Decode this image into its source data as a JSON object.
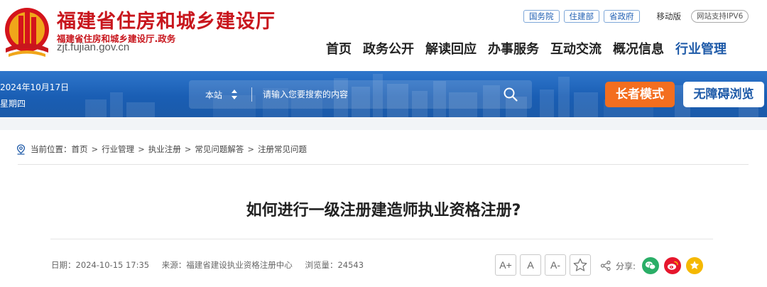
{
  "header": {
    "site_name": "福建省住房和城乡建设厅",
    "site_sub": "福建省住房和城乡建设厅.政务",
    "site_domain": "zjt.fujian.gov.cn",
    "top_links": [
      "国务院",
      "住建部",
      "省政府"
    ],
    "mobile_label": "移动版",
    "ipv6_label": "网站支持IPV6",
    "nav": [
      "首页",
      "政务公开",
      "解读回应",
      "办事服务",
      "互动交流",
      "概况信息",
      "行业管理"
    ],
    "active_nav": "行业管理"
  },
  "banner": {
    "date": "2024年10月17日",
    "weekday": "星期四",
    "search": {
      "scope": "本站",
      "placeholder": "请输入您要搜索的内容"
    },
    "elder_mode_label": "长者模式",
    "accessibility_label": "无障碍浏览"
  },
  "breadcrumb": {
    "prefix": "当前位置：",
    "items": [
      "首页",
      "行业管理",
      "执业注册",
      "常见问题解答",
      "注册常见问题"
    ],
    "separator": ">"
  },
  "article": {
    "title": "如何进行一级注册建造师执业资格注册?",
    "date_text": "日期：2024-10-15 17:35",
    "source_text": "来源：福建省建设执业资格注册中心",
    "views_text": "浏览量：24543",
    "font_controls": [
      "A+",
      "A",
      "A-"
    ],
    "share_label": "分享:"
  },
  "colors": {
    "brand_red": "#c8161d",
    "nav_active_blue": "#1e5aa8",
    "banner_blue": "#1a5eb4",
    "elder_orange": "#f36e1f",
    "wechat_green": "#2aae67",
    "weibo_red": "#e6162d",
    "favorite_yellow": "#f5b800"
  },
  "icons": [
    "emblem-logo",
    "location-pin-icon",
    "sort-arrows-icon",
    "search-icon",
    "star-icon",
    "share-icon",
    "wechat-icon",
    "weibo-icon",
    "favorite-icon"
  ]
}
